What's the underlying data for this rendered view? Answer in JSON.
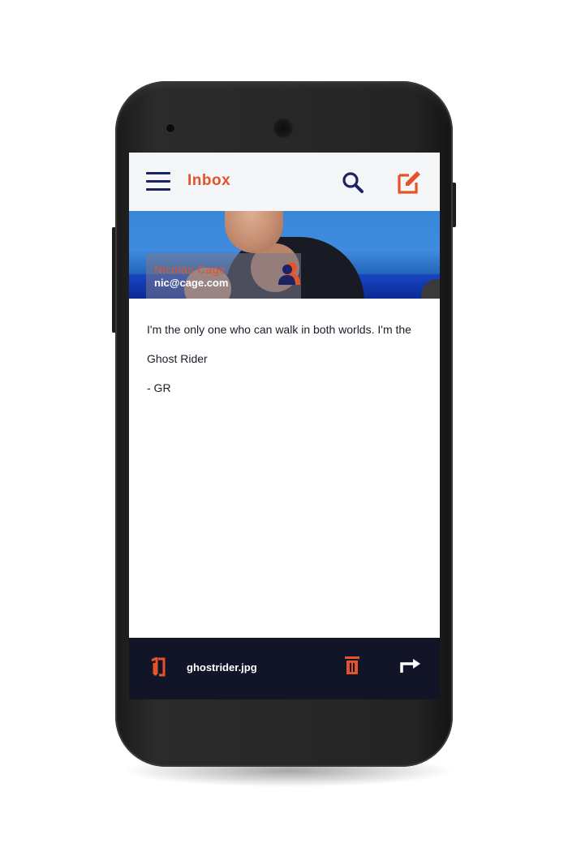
{
  "app": {
    "title": "Inbox",
    "accent_color": "#e4532a",
    "primary_color": "#1c2362",
    "bottom_bar_color": "#121428"
  },
  "appbar": {
    "menu_icon": "hamburger-menu-icon",
    "search_icon": "search-icon",
    "compose_icon": "compose-icon"
  },
  "sender": {
    "name": "Nicolas Cage",
    "email": "nic@cage.com",
    "avatar_icon": "person-icon"
  },
  "message": {
    "lines": [
      "I'm the only one who can walk in both worlds. I'm the",
      "Ghost Rider",
      "- GR"
    ]
  },
  "bottom_bar": {
    "attachment_icon": "attachment-icon",
    "attachment_name": "ghostrider.jpg",
    "delete_icon": "trash-icon",
    "forward_icon": "forward-arrow-icon"
  }
}
